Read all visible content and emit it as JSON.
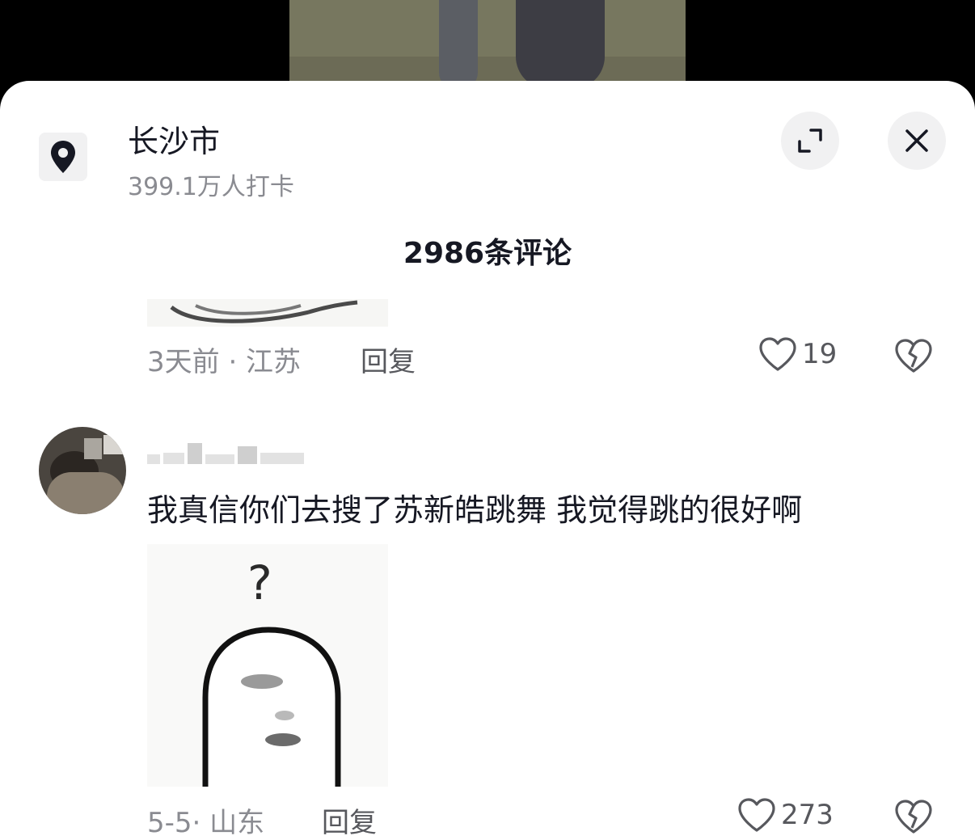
{
  "location": {
    "title": "长沙市",
    "subtitle": "399.1万人打卡"
  },
  "header": {
    "comments_count": "2986条评论"
  },
  "comments": [
    {
      "meta": "3天前 · 江苏",
      "reply_label": "回复",
      "likes": "19"
    },
    {
      "text": "我真信你们去搜了苏新皓跳舞 我觉得跳的很好啊",
      "meta": "5-5· 山东",
      "reply_label": "回复",
      "likes": "273"
    }
  ],
  "icons": {
    "location": "location-pin-icon",
    "expand": "expand-icon",
    "close": "close-icon",
    "like": "heart-icon",
    "dislike": "broken-heart-icon"
  },
  "colors": {
    "text_primary": "#161823",
    "text_secondary": "#8a8b91",
    "button_bg": "#f1f1f2"
  }
}
